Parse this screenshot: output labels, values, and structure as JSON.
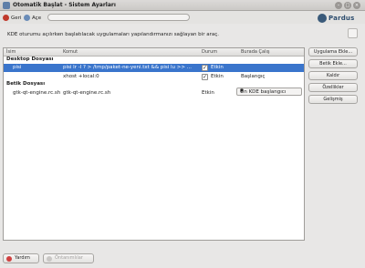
{
  "window": {
    "title": "Otomatik Başlat - Sistem Ayarları"
  },
  "toolbar": {
    "back_label": "Geri",
    "overview_label": "Açe",
    "search_placeholder": ""
  },
  "logo": {
    "text": "Pardus"
  },
  "description": "KDE oturumu açılırken başlatılacak uygulamaları yapılandırmanızı sağlayan bir araç.",
  "table": {
    "headers": {
      "name": "İsim",
      "command": "Komut",
      "status": "Durum",
      "run_on": "Burada Çalış"
    },
    "groups": [
      {
        "label": "Desktop Dosyası",
        "rows": [
          {
            "name": "pisi",
            "command": "pisi lr -l ? > /tmp/paket-ne-yeni.txt && pisi lu >> ...",
            "enabled": true,
            "status": "Etkin",
            "run_on": ""
          },
          {
            "name": "",
            "command": "xhost +local:0",
            "enabled": true,
            "status": "Etkin",
            "run_on": "Başlangıç"
          }
        ]
      },
      {
        "label": "Betik Dosyası",
        "rows": [
          {
            "name": "gtk-qt-engine.rc.sh",
            "command": "gtk-qt-engine.rc.sh",
            "enabled": false,
            "status": "Etkin",
            "run_on": "Ön KDE başlangıcı"
          }
        ]
      }
    ]
  },
  "side_buttons": {
    "add_program": "Uygulama Ekle...",
    "add_script": "Betik Ekle...",
    "remove": "Kaldır",
    "properties": "Özellikler",
    "advanced": "Gelişmiş"
  },
  "bottom": {
    "help_label": "Yardım",
    "defaults_label": "Öntanımlılar"
  },
  "colors": {
    "selection": "#3a75cc",
    "window_bg": "#e8e7e6"
  }
}
